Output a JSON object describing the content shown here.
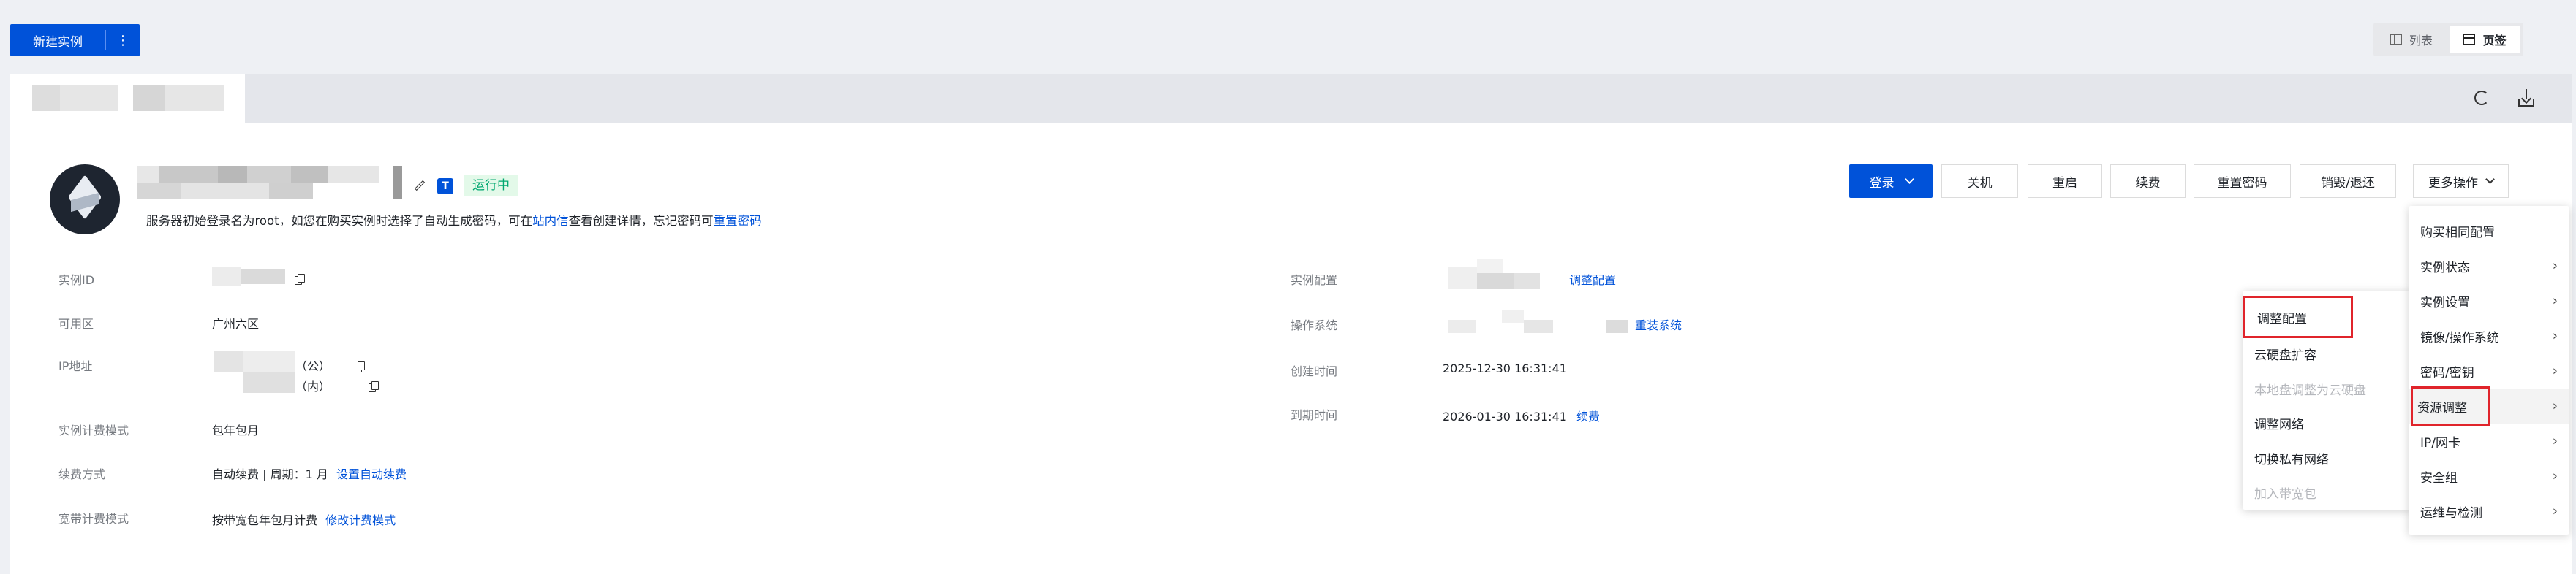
{
  "toolbar": {
    "new_instance": "新建实例",
    "more": "⋮"
  },
  "view_switch": {
    "list": "列表",
    "page": "页签"
  },
  "instance": {
    "status": "运行中",
    "hint_prefix": "服务器初始登录名为root，如您在购买实例时选择了自动生成密码，可在",
    "hint_link1": "站内信",
    "hint_mid": "查看创建详情，忘记密码可",
    "hint_link2": "重置密码"
  },
  "actions": {
    "login": "登录",
    "shutdown": "关机",
    "restart": "重启",
    "renew": "续费",
    "reset_password": "重置密码",
    "destroy": "销毁/退还",
    "more_ops": "更多操作"
  },
  "details_left": [
    {
      "label": "实例ID",
      "value": ""
    },
    {
      "label": "可用区",
      "value": "广州六区"
    },
    {
      "label": "IP地址",
      "public": "（公）",
      "private": "（内）"
    },
    {
      "label": "实例计费模式",
      "value": "包年包月"
    },
    {
      "label": "续费方式",
      "value": "自动续费 | 周期：1 月",
      "link": "设置自动续费"
    },
    {
      "label": "宽带计费模式",
      "value": "按带宽包年包月计费",
      "link": "修改计费模式"
    }
  ],
  "details_right": [
    {
      "label": "实例配置",
      "link": "调整配置"
    },
    {
      "label": "操作系统",
      "link": "重装系统"
    },
    {
      "label": "创建时间",
      "value": "2025-12-30 16:31:41"
    },
    {
      "label": "到期时间",
      "value": "2026-01-30 16:31:41",
      "link": "续费"
    }
  ],
  "more_menu": [
    {
      "label": "购买相同配置",
      "submenu": false
    },
    {
      "label": "实例状态",
      "submenu": true
    },
    {
      "label": "实例设置",
      "submenu": true
    },
    {
      "label": "镜像/操作系统",
      "submenu": true
    },
    {
      "label": "密码/密钥",
      "submenu": true
    },
    {
      "label": "资源调整",
      "submenu": true,
      "highlighted": true
    },
    {
      "label": "IP/网卡",
      "submenu": true
    },
    {
      "label": "安全组",
      "submenu": true
    },
    {
      "label": "运维与检测",
      "submenu": true
    }
  ],
  "resource_submenu": [
    {
      "label": "调整配置",
      "disabled": false,
      "highlighted": true
    },
    {
      "label": "云硬盘扩容",
      "disabled": false
    },
    {
      "label": "本地盘调整为云硬盘",
      "disabled": true
    },
    {
      "label": "调整网络",
      "disabled": false
    },
    {
      "label": "切换私有网络",
      "disabled": false
    },
    {
      "label": "加入带宽包",
      "disabled": true
    }
  ],
  "colors": {
    "primary": "#0052d9",
    "highlight_border": "#e0242b",
    "status_green": "#00a870"
  },
  "icons": [
    "more-vertical-icon",
    "list-icon",
    "page-tab-icon",
    "refresh-icon",
    "download-icon",
    "edit-icon",
    "tag-icon",
    "copy-icon",
    "chevron-down-icon",
    "chevron-right-icon",
    "instance-avatar-icon"
  ]
}
